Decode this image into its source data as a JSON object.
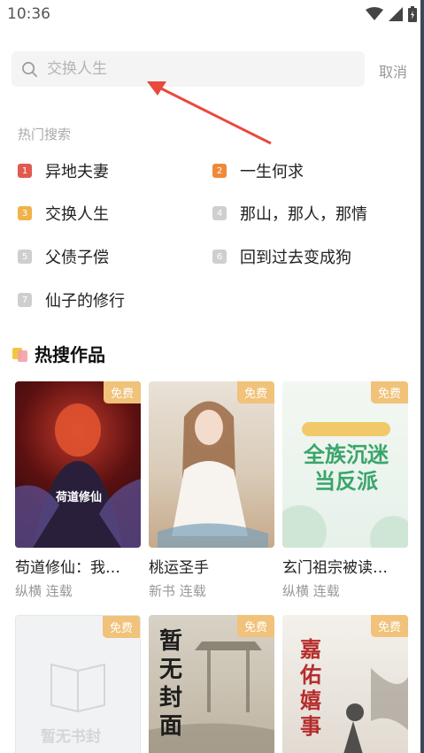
{
  "status": {
    "time": "10:36"
  },
  "search": {
    "placeholder": "交换人生",
    "value": "",
    "cancel_label": "取消"
  },
  "hot": {
    "title": "热门搜索",
    "items": [
      {
        "rank": "1",
        "label": "异地夫妻",
        "color": "#e05a4e"
      },
      {
        "rank": "2",
        "label": "一生何求",
        "color": "#ef8a3a"
      },
      {
        "rank": "3",
        "label": "交换人生",
        "color": "#f0b24a"
      },
      {
        "rank": "4",
        "label": "那山，那人，那情",
        "color": "#cfcfcf"
      },
      {
        "rank": "5",
        "label": "父债子偿",
        "color": "#cfcfcf"
      },
      {
        "rank": "6",
        "label": "回到过去变成狗",
        "color": "#cfcfcf"
      },
      {
        "rank": "7",
        "label": "仙子的修行",
        "color": "#cfcfcf"
      }
    ]
  },
  "section": {
    "title": "热搜作品"
  },
  "books": [
    {
      "badge": "免费",
      "title": "苟道修仙：我…",
      "meta": "纵横 连载",
      "cover_text": "荷道修仙"
    },
    {
      "badge": "免费",
      "title": "桃运圣手",
      "meta": "新书 连载"
    },
    {
      "badge": "免费",
      "title": "玄门祖宗被读…",
      "meta": "纵横 连载",
      "cover_text": "全族沉迷当反派"
    },
    {
      "badge": "免费",
      "title": "",
      "meta": "",
      "cover_text": "暂无书封"
    },
    {
      "badge": "免费",
      "title": "",
      "meta": "",
      "cover_text": "暂无封面"
    },
    {
      "badge": "免费",
      "title": "",
      "meta": "",
      "cover_text": "嘉佑嬉事"
    }
  ],
  "colors": {
    "accent": "#e84a3c",
    "badge": "#f0c27a"
  }
}
